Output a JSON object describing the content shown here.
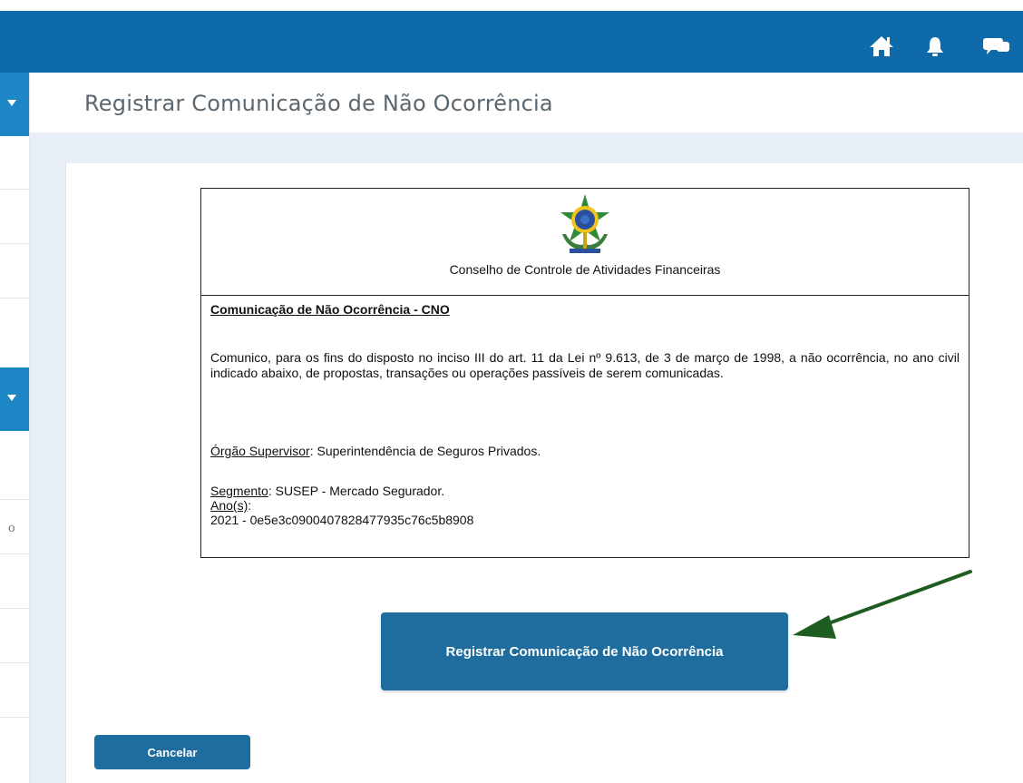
{
  "topbar": {
    "bg_color": "#0f6aaa",
    "icons": [
      "home-icon",
      "bell-icon",
      "chat-icon"
    ]
  },
  "sidebar": {
    "partial_text": "o"
  },
  "page": {
    "title": "Registrar Comunicação de Não Ocorrência"
  },
  "document": {
    "org_name": "Conselho de Controle de Atividades Financeiras",
    "heading": "Comunicação de Não Ocorrência - CNO",
    "paragraph": "Comunico, para os fins do disposto no inciso III do art. 11 da Lei nº 9.613, de 3 de março de 1998, a não ocorrência, no ano civil indicado abaixo, de propostas, transações ou operações passíveis de serem comunicadas.",
    "orgao_label": "Órgão Supervisor",
    "orgao_value": ": Superintendência de Seguros Privados.",
    "segmento_label": "Segmento",
    "segmento_value": ": SUSEP - Mercado Segurador.",
    "anos_label": "Ano(s)",
    "anos_colon": ":",
    "anos_value": "2021 - 0e5e3c0900407828477935c76c5b8908"
  },
  "actions": {
    "submit_label": "Registrar Comunicação de Não Ocorrência",
    "cancel_label": "Cancelar",
    "button_color": "#1f6d9f",
    "arrow_color": "#1f5c1f"
  }
}
